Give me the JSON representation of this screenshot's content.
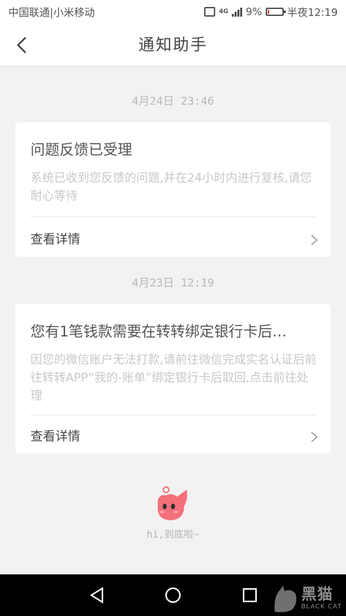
{
  "status_bar": {
    "carrier": "中国联通|小米移动",
    "network": "4G",
    "battery": "9%",
    "time": "半夜12:19",
    "battery_level": 0.09,
    "battery_color": "#e0403b"
  },
  "nav": {
    "title": "通知助手",
    "back_icon": "chevron-left-icon"
  },
  "notifications": [
    {
      "date": "4月24日 23:46",
      "title": "问题反馈已受理",
      "body": "系统已收到您反馈的问题,并在24小时内进行复核,请您耐心等待",
      "action": "查看详情"
    },
    {
      "date": "4月23日 12:19",
      "title": "您有1笔钱款需要在转转绑定银行卡后…",
      "body": "因您的微信账户无法打款,请前往微信完成实名认证后前往转转APP“我的-账单”绑定银行卡后取回,点击前往处理",
      "action": "查看详情"
    }
  ],
  "footer": {
    "end_text": "hi,到底啦~",
    "mascot_color": "#f4707a"
  },
  "watermark": {
    "cn": "黑猫",
    "en": "BLACK CAT"
  }
}
